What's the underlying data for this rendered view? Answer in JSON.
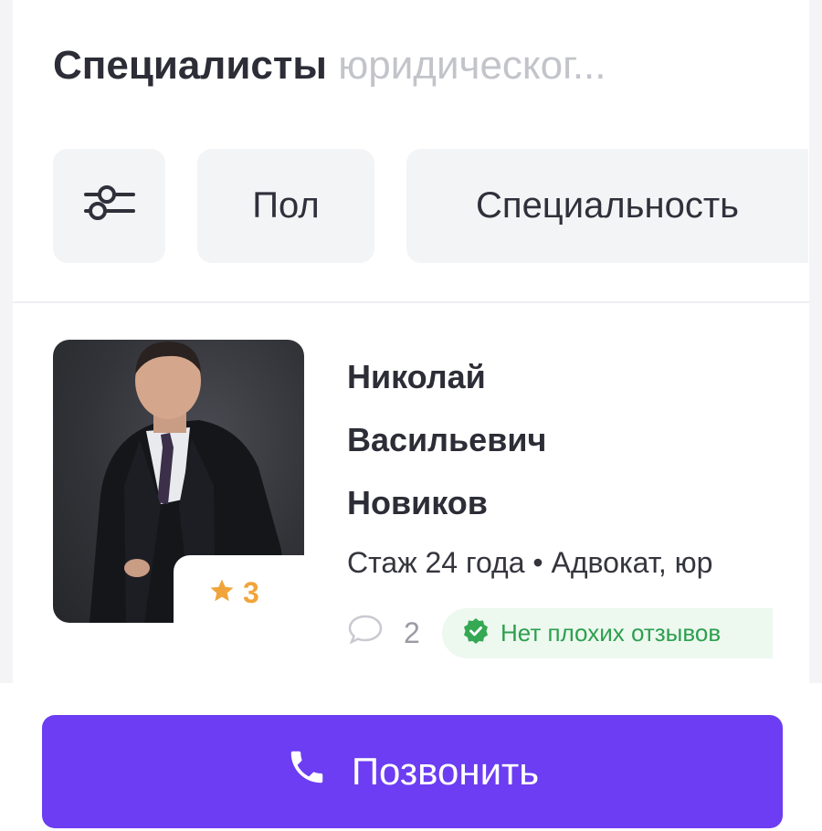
{
  "header": {
    "title_main": "Специалисты",
    "title_sub": "юридическог..."
  },
  "filters": {
    "filter_icon": "sliders-icon",
    "gender_label": "Пол",
    "specialty_label": "Специальность"
  },
  "specialist": {
    "name_first": "Николай",
    "name_middle": "Васильевич",
    "name_last": "Новиков",
    "rating": "3",
    "meta": "Стаж 24 года • Адвокат, юр",
    "reviews_count": "2",
    "no_bad_reviews": "Нет плохих отзывов"
  },
  "actions": {
    "call_label": "Позвонить"
  },
  "colors": {
    "accent": "#6c3df2",
    "rating": "#f0a43a",
    "positive": "#2e9f4f"
  }
}
